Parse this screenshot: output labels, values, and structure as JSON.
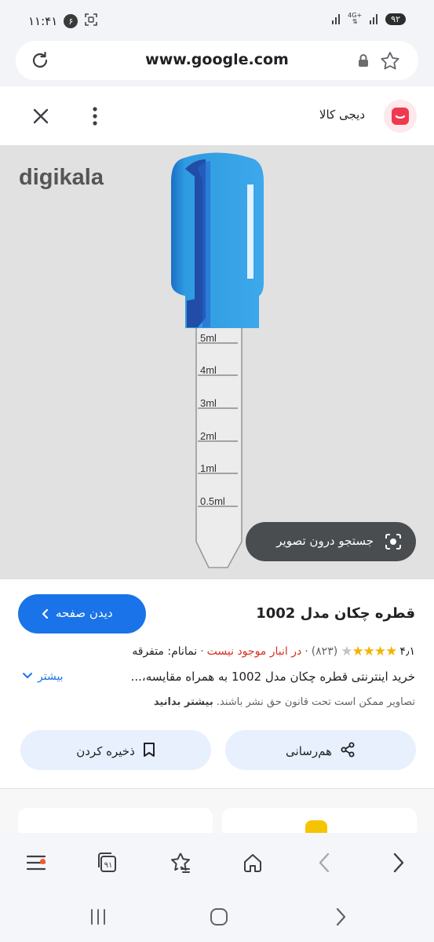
{
  "status_bar": {
    "time": "۱۱:۴۱",
    "notification_count": "۶",
    "battery": "۹۲",
    "network": "4G+"
  },
  "url_bar": {
    "url": "www.google.com"
  },
  "result_header": {
    "site_name": "دیجی کالا"
  },
  "image": {
    "brand_logo_text": "digikala",
    "measure_labels": [
      "5ml",
      "4ml",
      "3ml",
      "2ml",
      "1ml",
      "0.5ml"
    ],
    "lens_button_label": "جستجو درون تصویر"
  },
  "product": {
    "title": "قطره چکان مدل 1002",
    "open_button_label": "دیدن صفحه",
    "rating": "۴٫۱",
    "rating_stars": 4,
    "review_count": "(۸۲۳)",
    "availability": "در انبار موجود نیست",
    "brand": "نمانام: متفرقه",
    "description": "خرید اینترنتی قطره چکان مدل 1002 به همراه مقایسه،...",
    "more_label": "بیشتر",
    "copyright_text": "تصاویر ممکن است تحت قانون حق نشر باشند.",
    "copyright_more": "بیشتر بدانید",
    "share_label": "هم‌رسانی",
    "save_label": "ذخیره کردن"
  },
  "bottom_bar": {
    "tabs_count": "۹۱"
  },
  "colors": {
    "accent": "#1a73e8",
    "brand_red": "#ef394e",
    "star": "#f4b400",
    "out_of_stock": "#d93025",
    "dropper_bulb": "#2f9be0"
  }
}
